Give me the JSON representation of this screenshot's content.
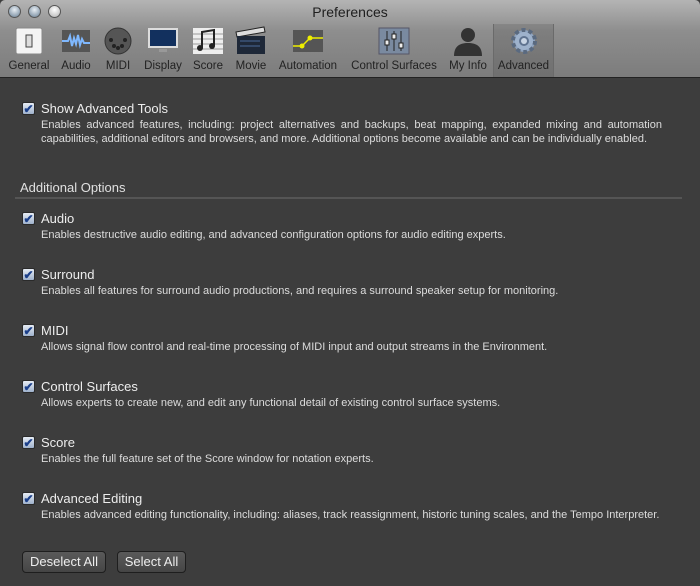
{
  "window": {
    "title": "Preferences"
  },
  "toolbar": [
    {
      "label": "General",
      "icon": "switch-icon"
    },
    {
      "label": "Audio",
      "icon": "waveform-icon"
    },
    {
      "label": "MIDI",
      "icon": "midi-connector-icon"
    },
    {
      "label": "Display",
      "icon": "monitor-icon"
    },
    {
      "label": "Score",
      "icon": "music-notes-icon"
    },
    {
      "label": "Movie",
      "icon": "clapperboard-icon"
    },
    {
      "label": "Automation",
      "icon": "automation-curve-icon"
    },
    {
      "label": "Control Surfaces",
      "icon": "faders-icon"
    },
    {
      "label": "My Info",
      "icon": "person-icon"
    },
    {
      "label": "Advanced",
      "icon": "gear-icon",
      "selected": true
    }
  ],
  "main": {
    "show_advanced": {
      "title": "Show Advanced Tools",
      "checked": true,
      "desc": "Enables advanced features, including: project alternatives and backups, beat mapping, expanded mixing and automation capabilities, additional editors and browsers, and more. Additional options become available and can be individually enabled."
    },
    "section_title": "Additional Options",
    "options": [
      {
        "title": "Audio",
        "checked": true,
        "desc": "Enables destructive audio editing, and advanced configuration options for audio editing experts."
      },
      {
        "title": "Surround",
        "checked": true,
        "desc": "Enables all features for surround audio productions, and requires a surround speaker setup for monitoring."
      },
      {
        "title": "MIDI",
        "checked": true,
        "desc": "Allows signal flow control and real-time processing of MIDI input and output streams in the Environment."
      },
      {
        "title": "Control Surfaces",
        "checked": true,
        "desc": "Allows experts to create new, and edit any functional detail of existing control surface systems."
      },
      {
        "title": "Score",
        "checked": true,
        "desc": "Enables the full feature set of the Score window for notation experts."
      },
      {
        "title": "Advanced Editing",
        "checked": true,
        "desc": "Enables advanced editing functionality, including: aliases, track reassignment, historic tuning scales, and the Tempo Interpreter."
      }
    ],
    "deselect_all": "Deselect All",
    "select_all": "Select All",
    "check_glyph": "✔"
  }
}
